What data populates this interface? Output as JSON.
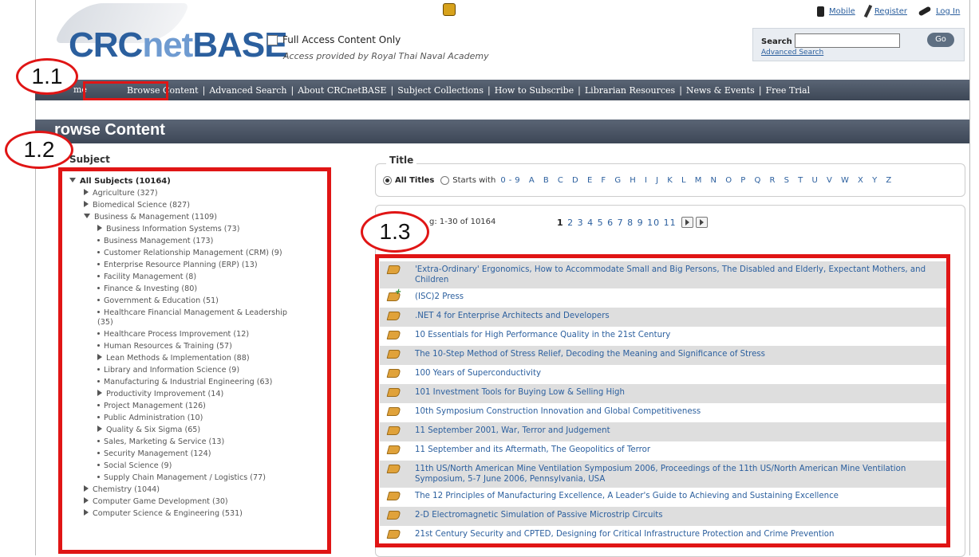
{
  "header": {
    "logo_crc": "CRC",
    "logo_net": "net",
    "logo_base": "BASE",
    "full_access_label": "Full Access Content Only",
    "provided_by": "Access provided by Royal Thai Naval Academy",
    "links": {
      "mobile": "Mobile",
      "register": "Register",
      "login": "Log In"
    },
    "search": {
      "label": "Search",
      "value": "",
      "go": "Go",
      "advanced": "Advanced Search"
    }
  },
  "nav": {
    "home": "me",
    "items": [
      "Browse Content",
      "Advanced Search",
      "About CRCnetBASE",
      "Subject Collections",
      "How to Subscribe",
      "Librarian Resources",
      "News & Events",
      "Free Trial"
    ]
  },
  "page_title": "rowse Content",
  "callouts": {
    "c1": "1.1",
    "c2": "1.2",
    "c3": "1.3"
  },
  "subject": {
    "header": "Subject",
    "root": "All Subjects (10164)",
    "items": [
      {
        "label": "Agriculture (327)"
      },
      {
        "label": "Biomedical Science (827)"
      },
      {
        "label": "Business & Management (1109)"
      },
      {
        "label": "Business Information Systems (73)"
      },
      {
        "label": "Business Management (173)"
      },
      {
        "label": "Customer Relationship Management (CRM) (9)"
      },
      {
        "label": "Enterprise Resource Planning (ERP) (13)"
      },
      {
        "label": "Facility Management (8)"
      },
      {
        "label": "Finance & Investing (80)"
      },
      {
        "label": "Government & Education (51)"
      },
      {
        "label": "Healthcare Financial Management & Leadership (35)"
      },
      {
        "label": "Healthcare Process Improvement (12)"
      },
      {
        "label": "Human Resources & Training (57)"
      },
      {
        "label": "Lean Methods & Implementation (88)"
      },
      {
        "label": "Library and Information Science (9)"
      },
      {
        "label": "Manufacturing & Industrial Engineering (63)"
      },
      {
        "label": "Productivity Improvement (14)"
      },
      {
        "label": "Project Management (126)"
      },
      {
        "label": "Public Administration (10)"
      },
      {
        "label": "Quality & Six Sigma (65)"
      },
      {
        "label": "Sales, Marketing & Service (13)"
      },
      {
        "label": "Security Management (124)"
      },
      {
        "label": "Social Science (9)"
      },
      {
        "label": "Supply Chain Management / Logistics (77)"
      },
      {
        "label": "Chemistry (1044)"
      },
      {
        "label": "Computer Game Development (30)"
      },
      {
        "label": "Computer Science & Engineering (531)"
      }
    ]
  },
  "title_filter": {
    "label": "Title",
    "all_titles": "All Titles",
    "starts_with": "Starts with",
    "letters": "0-9 A B C D E F G H I J K L M N O P Q R S T U V W X Y Z"
  },
  "results": {
    "showing": "g: 1-30 of 10164",
    "current_page": "1",
    "other_pages": "2 3 4 5 6 7 8 9 10 11",
    "items": [
      "'Extra-Ordinary' Ergonomics, How to Accommodate Small and Big Persons, The Disabled and Elderly, Expectant Mothers, and Children",
      "(ISC)2 Press",
      ".NET 4 for Enterprise Architects and Developers",
      "10 Essentials for High Performance Quality in the 21st Century",
      "The 10-Step Method of Stress Relief, Decoding the Meaning and Significance of Stress",
      "100 Years of Superconductivity",
      "101 Investment Tools for Buying Low & Selling High",
      "10th Symposium Construction Innovation and Global Competitiveness",
      "11 September 2001, War, Terror and Judgement",
      "11 September and its Aftermath, The Geopolitics of Terror",
      "11th US/North American Mine Ventilation Symposium 2006, Proceedings of the 11th US/North American Mine Ventilation Symposium, 5-7 June 2006, Pennsylvania, USA",
      "The 12 Principles of Manufacturing Excellence, A Leader's Guide to Achieving and Sustaining Excellence",
      "2-D Electromagnetic Simulation of Passive Microstrip Circuits",
      "21st Century Security and CPTED, Designing for Critical Infrastructure Protection and Crime Prevention"
    ]
  }
}
